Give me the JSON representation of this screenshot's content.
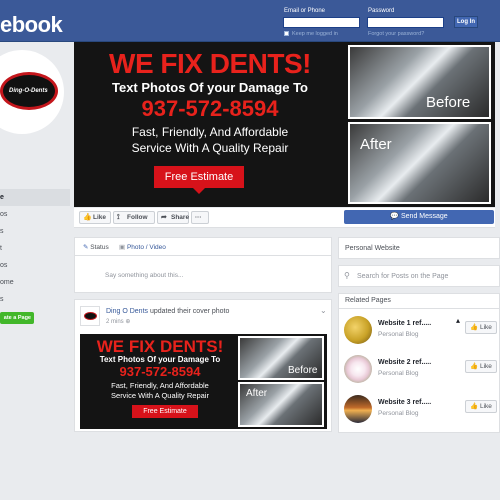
{
  "header": {
    "logo": "ebook",
    "email_label": "Email or Phone",
    "password_label": "Password",
    "login_button": "Log In",
    "keep_logged_in": "Keep me logged in",
    "forgot_password": "Forgot your password?"
  },
  "sidebar": {
    "logo_text": "Ding-O-Dents",
    "items": [
      {
        "label": "e"
      },
      {
        "label": "os"
      },
      {
        "label": "s"
      },
      {
        "label": "t"
      },
      {
        "label": "os"
      },
      {
        "label": "ome"
      },
      {
        "label": "s"
      }
    ],
    "create_page": "ate a Page"
  },
  "cover": {
    "title": "WE FIX DENTS!",
    "subtitle": "Text Photos Of your Damage To",
    "phone": "937-572-8594",
    "line1": "Fast, Friendly, And Affordable",
    "line2": "Service With A Quality Repair",
    "button": "Free Estimate",
    "before_label": "Before",
    "after_label": "After"
  },
  "actions": {
    "like": "Like",
    "follow": "Follow",
    "share": "Share",
    "more": "···",
    "send_message": "Send Message"
  },
  "composer": {
    "status_tab": "Status",
    "photo_tab": "Photo / Video",
    "placeholder": "Say something about this..."
  },
  "post": {
    "author": "Ding O Dents",
    "action": "updated their cover photo",
    "time": "2 mins",
    "image": {
      "title": "WE FIX DENTS!",
      "subtitle": "Text Photos Of your Damage To",
      "phone": "937-572-8594",
      "line1": "Fast, Friendly, And Affordable",
      "line2": "Service With A Quality Repair",
      "button": "Free Estimate",
      "before_label": "Before",
      "after_label": "After"
    }
  },
  "right": {
    "website_label": "Personal Website",
    "search_placeholder": "Search for Posts on the Page",
    "related_title": "Related Pages",
    "related": [
      {
        "name": "Website 1 ref.....",
        "category": "Personal Blog",
        "like": "Like",
        "thumb_color": "#c9a227"
      },
      {
        "name": "Website 2 ref.....",
        "category": "Personal Blog",
        "like": "Like",
        "thumb_color": "#e9c9d6"
      },
      {
        "name": "Website 3 ref.....",
        "category": "Personal Blog",
        "like": "Like",
        "thumb_color": "#c06a2a"
      }
    ]
  },
  "colors": {
    "facebook_blue": "#3b5998",
    "brand_red": "#d7121a",
    "like_green": "#42b72a"
  }
}
